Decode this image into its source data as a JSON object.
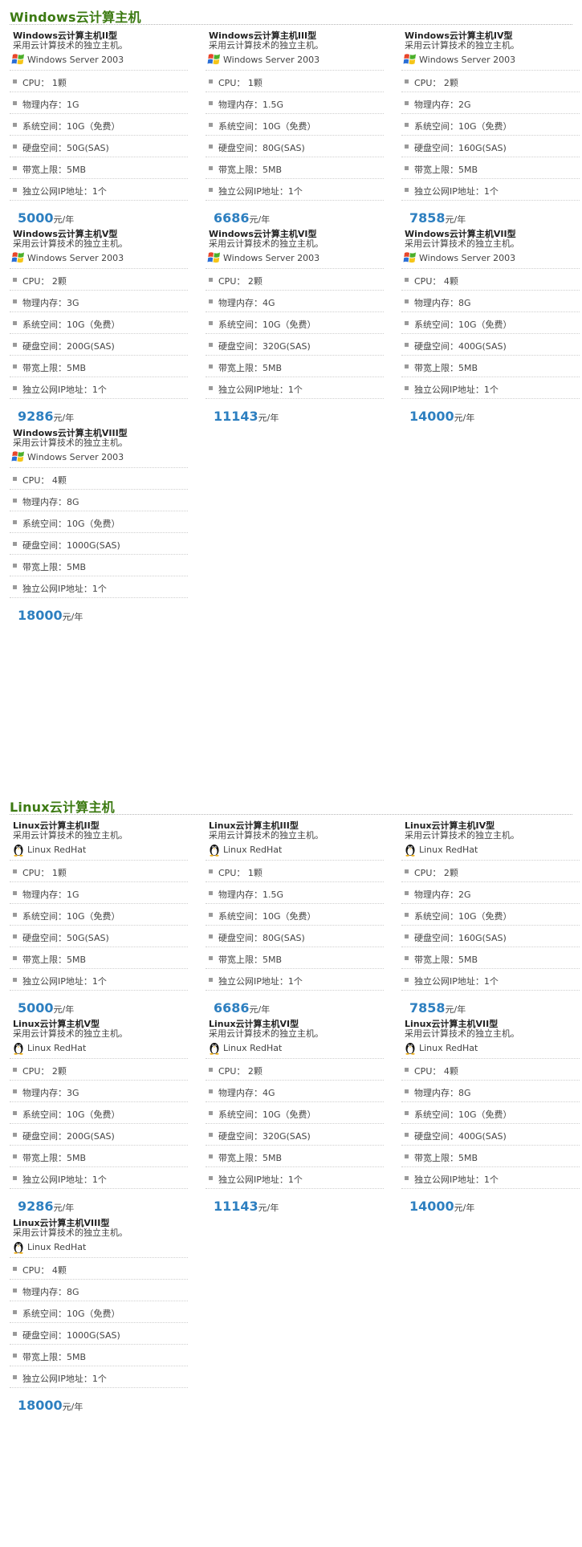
{
  "sections": [
    {
      "title": "Windows云计算主机",
      "icon": "windows-flag-icon",
      "os": "Windows Server 2003",
      "cards": [
        {
          "name": "Windows云计算主机II型",
          "price": "5000",
          "specs": [
            "CPU：  1颗",
            "物理内存：1G",
            "系统空间：10G（免费）",
            "硬盘空间：50G(SAS)",
            "带宽上限：5MB",
            "独立公网IP地址：1个"
          ]
        },
        {
          "name": "Windows云计算主机III型",
          "price": "6686",
          "specs": [
            "CPU：  1颗",
            "物理内存：1.5G",
            "系统空间：10G（免费）",
            "硬盘空间：80G(SAS)",
            "带宽上限：5MB",
            "独立公网IP地址：1个"
          ]
        },
        {
          "name": "Windows云计算主机IV型",
          "price": "7858",
          "specs": [
            "CPU：  2颗",
            "物理内存：2G",
            "系统空间：10G（免费）",
            "硬盘空间：160G(SAS)",
            "带宽上限：5MB",
            "独立公网IP地址：1个"
          ]
        },
        {
          "name": "Windows云计算主机V型",
          "price": "9286",
          "specs": [
            "CPU：  2颗",
            "物理内存：3G",
            "系统空间：10G（免费）",
            "硬盘空间：200G(SAS)",
            "带宽上限：5MB",
            "独立公网IP地址：1个"
          ]
        },
        {
          "name": "Windows云计算主机VI型",
          "price": "11143",
          "specs": [
            "CPU：  2颗",
            "物理内存：4G",
            "系统空间：10G（免费）",
            "硬盘空间：320G(SAS)",
            "带宽上限：5MB",
            "独立公网IP地址：1个"
          ]
        },
        {
          "name": "Windows云计算主机VII型",
          "price": "14000",
          "specs": [
            "CPU：  4颗",
            "物理内存：8G",
            "系统空间：10G（免费）",
            "硬盘空间：400G(SAS)",
            "带宽上限：5MB",
            "独立公网IP地址：1个"
          ]
        },
        {
          "name": "Windows云计算主机VIII型",
          "price": "18000",
          "specs": [
            "CPU：  4颗",
            "物理内存：8G",
            "系统空间：10G（免费）",
            "硬盘空间：1000G(SAS)",
            "带宽上限：5MB",
            "独立公网IP地址：1个"
          ]
        }
      ]
    },
    {
      "title": "Linux云计算主机",
      "icon": "linux-penguin-icon",
      "os": "Linux RedHat",
      "cards": [
        {
          "name": "Linux云计算主机II型",
          "price": "5000",
          "specs": [
            "CPU：  1颗",
            "物理内存：1G",
            "系统空间：10G（免费）",
            "硬盘空间：50G(SAS)",
            "带宽上限：5MB",
            "独立公网IP地址：1个"
          ]
        },
        {
          "name": "Linux云计算主机III型",
          "price": "6686",
          "specs": [
            "CPU：  1颗",
            "物理内存：1.5G",
            "系统空间：10G（免费）",
            "硬盘空间：80G(SAS)",
            "带宽上限：5MB",
            "独立公网IP地址：1个"
          ]
        },
        {
          "name": "Linux云计算主机IV型",
          "price": "7858",
          "specs": [
            "CPU：  2颗",
            "物理内存：2G",
            "系统空间：10G（免费）",
            "硬盘空间：160G(SAS)",
            "带宽上限：5MB",
            "独立公网IP地址：1个"
          ]
        },
        {
          "name": "Linux云计算主机V型",
          "price": "9286",
          "specs": [
            "CPU：  2颗",
            "物理内存：3G",
            "系统空间：10G（免费）",
            "硬盘空间：200G(SAS)",
            "带宽上限：5MB",
            "独立公网IP地址：1个"
          ]
        },
        {
          "name": "Linux云计算主机VI型",
          "price": "11143",
          "specs": [
            "CPU：  2颗",
            "物理内存：4G",
            "系统空间：10G（免费）",
            "硬盘空间：320G(SAS)",
            "带宽上限：5MB",
            "独立公网IP地址：1个"
          ]
        },
        {
          "name": "Linux云计算主机VII型",
          "price": "14000",
          "specs": [
            "CPU：  4颗",
            "物理内存：8G",
            "系统空间：10G（免费）",
            "硬盘空间：400G(SAS)",
            "带宽上限：5MB",
            "独立公网IP地址：1个"
          ]
        },
        {
          "name": "Linux云计算主机VIII型",
          "price": "18000",
          "specs": [
            "CPU：  4颗",
            "物理内存：8G",
            "系统空间：10G（免费）",
            "硬盘空间：1000G(SAS)",
            "带宽上限：5MB",
            "独立公网IP地址：1个"
          ]
        }
      ]
    }
  ],
  "common": {
    "desc": "采用云计算技术的独立主机。",
    "price_unit": "元/年",
    "colors": {
      "section_title": "#3c7a12",
      "price": "#2d7fc0"
    }
  }
}
